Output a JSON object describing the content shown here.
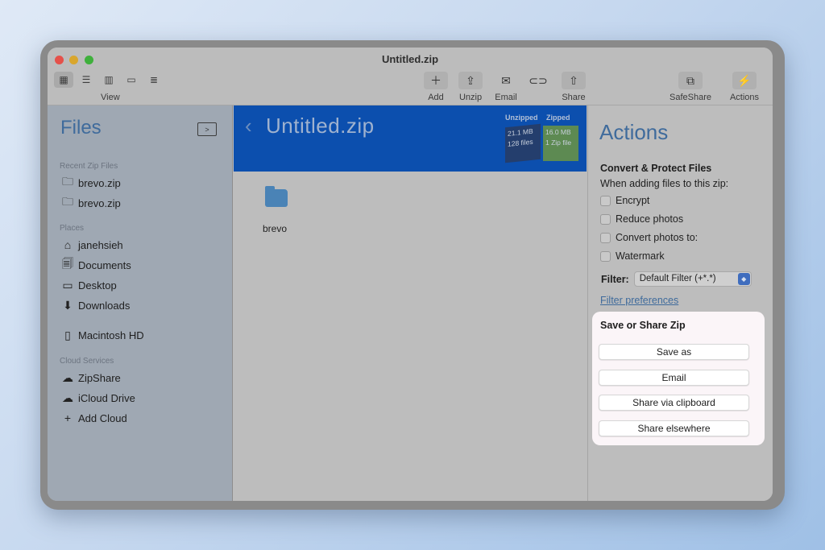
{
  "window": {
    "title": "Untitled.zip"
  },
  "toolbar": {
    "view_label": "View",
    "view_icons": [
      "grid-view-icon",
      "list-view-icon",
      "column-view-icon",
      "gallery-view-icon",
      "outline-view-icon"
    ],
    "buttons": [
      {
        "label": "Add",
        "icon": "plus-icon"
      },
      {
        "label": "Unzip",
        "icon": "unzip-icon"
      },
      {
        "label": "Email",
        "icon": "envelope-icon"
      },
      {
        "label": "Link",
        "icon": "link-icon"
      },
      {
        "label": "Share",
        "icon": "share-icon"
      },
      {
        "label": "SafeShare",
        "icon": "safeshare-icon"
      },
      {
        "label": "Actions",
        "icon": "bolt-icon"
      }
    ]
  },
  "sidebar": {
    "title": "Files",
    "recent_header": "Recent Zip Files",
    "recent": [
      {
        "label": "brevo.zip"
      },
      {
        "label": "brevo.zip"
      }
    ],
    "places_header": "Places",
    "places": [
      {
        "label": "janehsieh",
        "icon": "home-icon"
      },
      {
        "label": "Documents",
        "icon": "documents-icon"
      },
      {
        "label": "Desktop",
        "icon": "desktop-icon"
      },
      {
        "label": "Downloads",
        "icon": "downloads-icon"
      },
      {
        "label": "Macintosh HD",
        "icon": "hard-drive-icon"
      }
    ],
    "cloud_header": "Cloud Services",
    "cloud": [
      {
        "label": "ZipShare",
        "icon": "cloud-filled-icon"
      },
      {
        "label": "iCloud Drive",
        "icon": "cloud-outline-icon"
      },
      {
        "label": "Add Cloud",
        "icon": "plus-icon"
      }
    ]
  },
  "main": {
    "banner_title": "Untitled.zip",
    "unzipped_header": "Unzipped",
    "zipped_header": "Zipped",
    "unzipped_size": "21.1 MB",
    "unzipped_count": "128 files",
    "zipped_size": "16.0 MB",
    "zipped_count": "1 Zip file",
    "items": [
      {
        "name": "brevo"
      }
    ]
  },
  "actions": {
    "title": "Actions",
    "convert_header": "Convert & Protect Files",
    "convert_hint": "When adding files to this zip:",
    "options": [
      {
        "label": "Encrypt",
        "checked": false
      },
      {
        "label": "Reduce photos",
        "checked": false
      },
      {
        "label": "Convert photos to:",
        "checked": false
      },
      {
        "label": "Watermark",
        "checked": false
      }
    ],
    "filter_label": "Filter:",
    "filter_value": "Default Filter (+*.*)",
    "filter_link": "Filter preferences",
    "share_header": "Save or Share Zip",
    "share_buttons": [
      "Save as",
      "Email",
      "Share via clipboard",
      "Share elsewhere"
    ]
  }
}
